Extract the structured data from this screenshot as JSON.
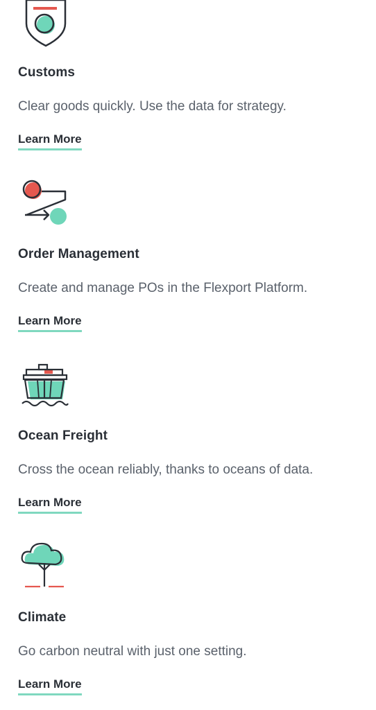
{
  "colors": {
    "ink": "#2a2f36",
    "teal": "#6fd6b9",
    "red": "#e5584f",
    "underline": "#7fd8bf"
  },
  "cards": [
    {
      "icon": "customs-shield-icon",
      "title": "Customs",
      "description": "Clear goods quickly. Use the data for strategy.",
      "link": "Learn More"
    },
    {
      "icon": "order-management-icon",
      "title": "Order Management",
      "description": "Create and manage POs in the Flexport Platform.",
      "link": "Learn More"
    },
    {
      "icon": "ocean-freight-ship-icon",
      "title": "Ocean Freight",
      "description": "Cross the ocean reliably, thanks to oceans of data.",
      "link": "Learn More"
    },
    {
      "icon": "climate-tree-icon",
      "title": "Climate",
      "description": "Go carbon neutral with just one setting.",
      "link": "Learn More"
    }
  ]
}
